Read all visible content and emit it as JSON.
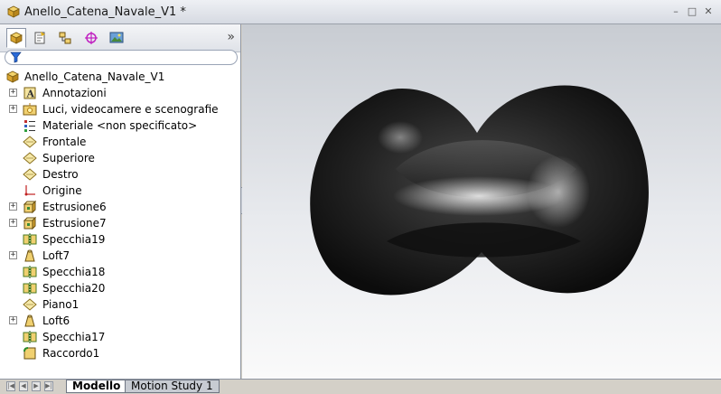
{
  "window": {
    "title": "Anello_Catena_Navale_V1 *"
  },
  "feature_tree": {
    "root": "Anello_Catena_Navale_V1",
    "items": [
      {
        "label": "Annotazioni",
        "icon": "annotation-icon",
        "expandable": true
      },
      {
        "label": "Luci, videocamere e scenografie",
        "icon": "lights-icon",
        "expandable": true
      },
      {
        "label": "Materiale <non specificato>",
        "icon": "material-icon",
        "expandable": false
      },
      {
        "label": "Frontale",
        "icon": "plane-icon",
        "expandable": false
      },
      {
        "label": "Superiore",
        "icon": "plane-icon",
        "expandable": false
      },
      {
        "label": "Destro",
        "icon": "plane-icon",
        "expandable": false
      },
      {
        "label": "Origine",
        "icon": "origin-icon",
        "expandable": false
      },
      {
        "label": "Estrusione6",
        "icon": "extrude-icon",
        "expandable": true
      },
      {
        "label": "Estrusione7",
        "icon": "extrude-icon",
        "expandable": true
      },
      {
        "label": "Specchia19",
        "icon": "mirror-icon",
        "expandable": false
      },
      {
        "label": "Loft7",
        "icon": "loft-icon",
        "expandable": true
      },
      {
        "label": "Specchia18",
        "icon": "mirror-icon",
        "expandable": false
      },
      {
        "label": "Specchia20",
        "icon": "mirror-icon",
        "expandable": false
      },
      {
        "label": "Piano1",
        "icon": "plane-icon",
        "expandable": false
      },
      {
        "label": "Loft6",
        "icon": "loft-icon",
        "expandable": true
      },
      {
        "label": "Specchia17",
        "icon": "mirror-icon",
        "expandable": false
      },
      {
        "label": "Raccordo1",
        "icon": "fillet-icon",
        "expandable": false
      }
    ]
  },
  "bottom_tabs": [
    {
      "label": "Modello",
      "active": true
    },
    {
      "label": "Motion Study 1",
      "active": false
    }
  ],
  "colors": {
    "viewport_top": "#c8ccd2",
    "viewport_bottom": "#fafafa",
    "model": "#1e1e1e"
  }
}
